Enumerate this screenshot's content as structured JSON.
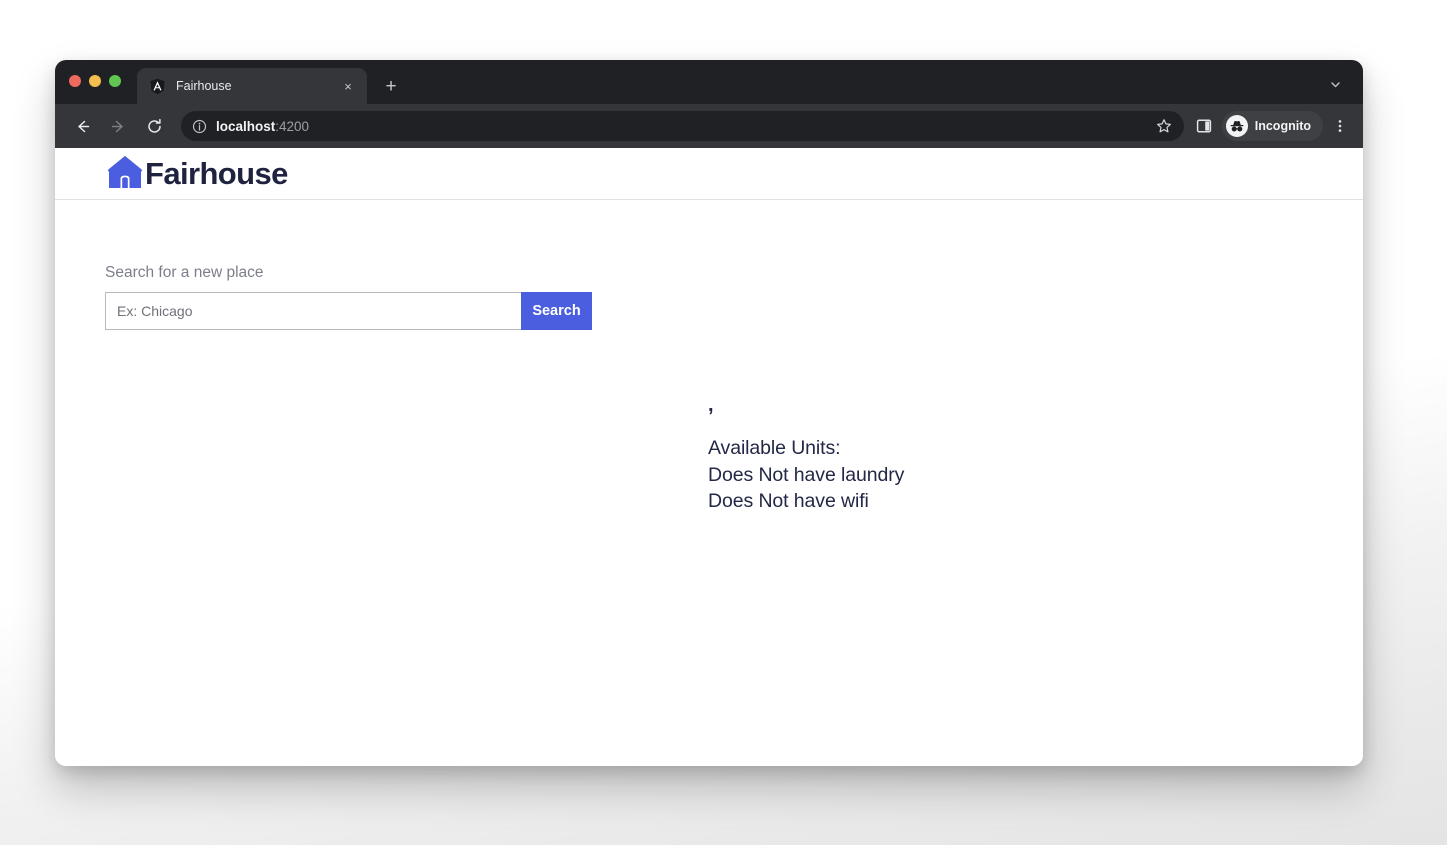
{
  "browser": {
    "traffic_lights": [
      "close",
      "minimize",
      "zoom"
    ],
    "tab": {
      "title": "Fairhouse",
      "favicon": "angular-logo-icon",
      "close_label": "×"
    },
    "new_tab_label": "+",
    "tab_search_icon": "chevron-down-icon",
    "toolbar": {
      "back_icon": "arrow-left-icon",
      "forward_icon": "arrow-right-icon",
      "reload_icon": "reload-icon",
      "site_info_icon": "info-circle-icon",
      "url_host": "localhost",
      "url_port": ":4200",
      "star_icon": "star-icon",
      "side_panel_icon": "side-panel-icon",
      "profile_label": "Incognito",
      "profile_icon": "incognito-icon",
      "menu_icon": "kebab-menu-icon"
    }
  },
  "page": {
    "brand": {
      "name": "Fairhouse",
      "logo_icon": "house-icon",
      "logo_color": "#4c5ee0",
      "text_color": "#1f2340"
    },
    "search": {
      "label": "Search for a new place",
      "placeholder": "Ex: Chicago",
      "value": "",
      "button_label": "Search",
      "button_color": "#4c5ee0"
    },
    "place_details": {
      "location": ",",
      "available_units_label": "Available Units:",
      "lines": [
        "Does Not have laundry",
        "Does Not have wifi"
      ]
    }
  }
}
